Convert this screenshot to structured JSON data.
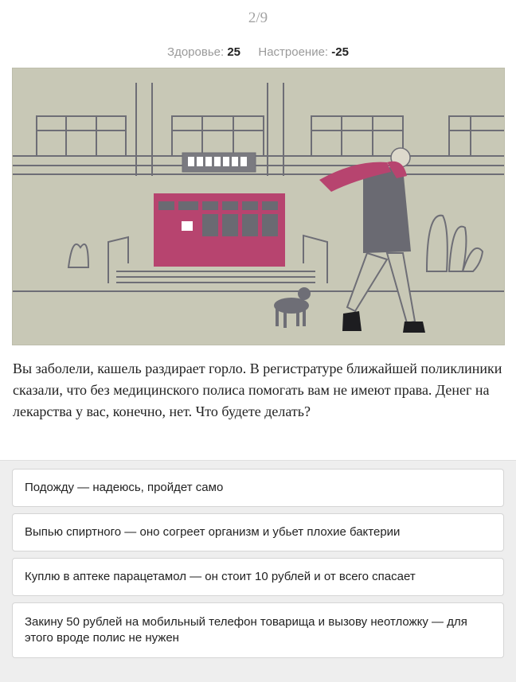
{
  "progress": {
    "counter": "2/9"
  },
  "stats": {
    "health_label": "Здоровье:",
    "health_value": "25",
    "mood_label": "Настроение:",
    "mood_value": "-25"
  },
  "illustration": {
    "icon": "clinic-scene-illustration",
    "colors": {
      "background": "#c8c8b6",
      "accent": "#b7446f",
      "ink": "#6e6e76"
    }
  },
  "question": {
    "text": "Вы заболели, кашель раздирает горло. В регистратуре ближайшей поликлиники сказали, что без медицинского полиса помогать вам не имеют права. Денег на лекарства у вас, конечно, нет. Что будете делать?"
  },
  "answers": [
    {
      "label": "Подожду — надеюсь, пройдет само"
    },
    {
      "label": "Выпью спиртного — оно согреет организм и убьет плохие бактерии"
    },
    {
      "label": "Куплю в аптеке парацетамол — он стоит 10 рублей и от всего спасает"
    },
    {
      "label": "Закину 50 рублей на мобильный телефон товарища и вызову неотложку — для этого вроде полис не нужен"
    }
  ]
}
